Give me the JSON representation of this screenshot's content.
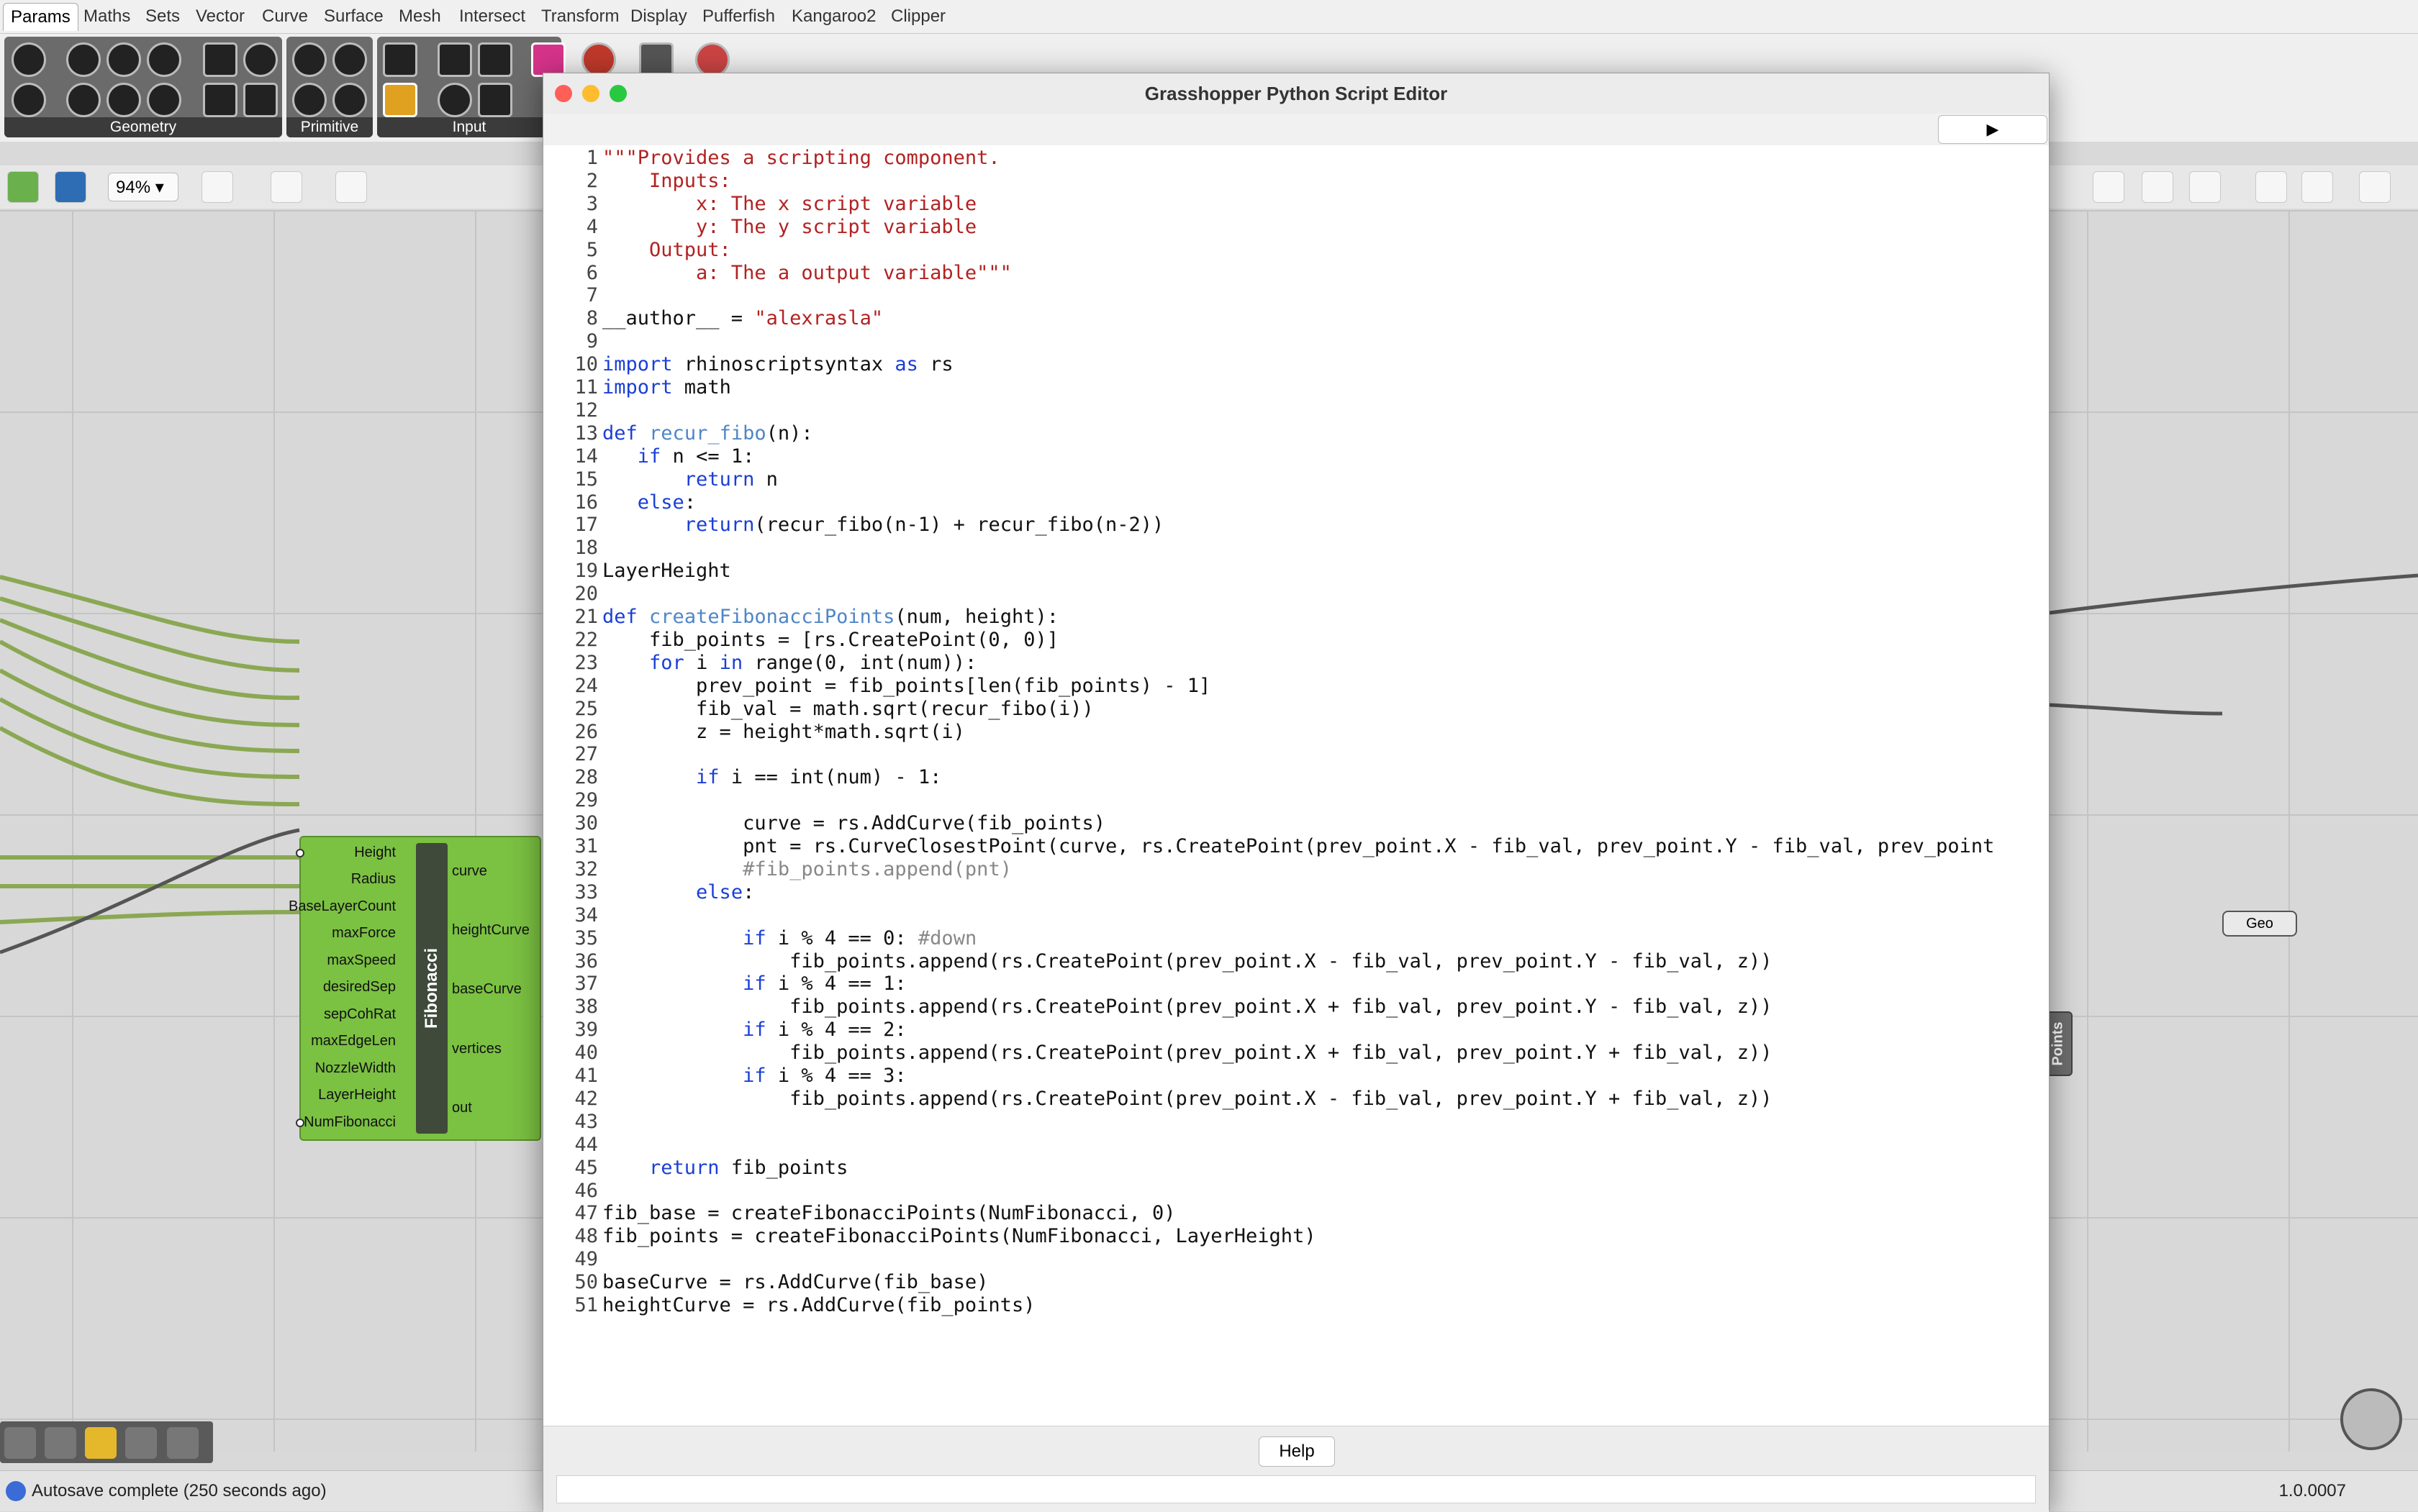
{
  "menu_tabs": [
    "Params",
    "Maths",
    "Sets",
    "Vector",
    "Curve",
    "Surface",
    "Mesh",
    "Intersect",
    "Transform",
    "Display",
    "Pufferfish",
    "Kangaroo2",
    "Clipper"
  ],
  "ribbon": {
    "groups": [
      "Geometry",
      "Primitive",
      "Input"
    ]
  },
  "toolbar": {
    "zoom": "94%"
  },
  "component": {
    "name": "Fibonacci",
    "inputs": [
      "Height",
      "Radius",
      "BaseLayerCount",
      "maxForce",
      "maxSpeed",
      "desiredSep",
      "sepCohRat",
      "maxEdgeLen",
      "NozzleWidth",
      "LayerHeight",
      "NumFibonacci"
    ],
    "outputs": [
      "curve",
      "heightCurve",
      "baseCurve",
      "vertices",
      "out"
    ]
  },
  "geo_param": "Geo",
  "points_param": "Points",
  "editor": {
    "title": "Grasshopper Python Script Editor",
    "run_label": "▶",
    "help_label": "Help",
    "lines": [
      "\"\"\"Provides a scripting component.",
      "    Inputs:",
      "        x: The x script variable",
      "        y: The y script variable",
      "    Output:",
      "        a: The a output variable\"\"\"",
      "",
      "__author__ = \"alexrasla\"",
      "",
      "import rhinoscriptsyntax as rs",
      "import math",
      "",
      "def recur_fibo(n):",
      "   if n <= 1:",
      "       return n",
      "   else:",
      "       return(recur_fibo(n-1) + recur_fibo(n-2))",
      "",
      "LayerHeight",
      "",
      "def createFibonacciPoints(num, height):",
      "    fib_points = [rs.CreatePoint(0, 0)]",
      "    for i in range(0, int(num)):",
      "        prev_point = fib_points[len(fib_points) - 1]",
      "        fib_val = math.sqrt(recur_fibo(i))",
      "        z = height*math.sqrt(i)",
      "",
      "        if i == int(num) - 1:",
      "",
      "            curve = rs.AddCurve(fib_points)",
      "            pnt = rs.CurveClosestPoint(curve, rs.CreatePoint(prev_point.X - fib_val, prev_point.Y - fib_val, prev_point",
      "            #fib_points.append(pnt)",
      "        else:",
      "",
      "            if i % 4 == 0: #down",
      "                fib_points.append(rs.CreatePoint(prev_point.X - fib_val, prev_point.Y - fib_val, z))",
      "            if i % 4 == 1:",
      "                fib_points.append(rs.CreatePoint(prev_point.X + fib_val, prev_point.Y - fib_val, z))",
      "            if i % 4 == 2:",
      "                fib_points.append(rs.CreatePoint(prev_point.X + fib_val, prev_point.Y + fib_val, z))",
      "            if i % 4 == 3:",
      "                fib_points.append(rs.CreatePoint(prev_point.X - fib_val, prev_point.Y + fib_val, z))",
      "",
      "",
      "    return fib_points",
      "",
      "fib_base = createFibonacciPoints(NumFibonacci, 0)",
      "fib_points = createFibonacciPoints(NumFibonacci, LayerHeight)",
      "",
      "baseCurve = rs.AddCurve(fib_base)",
      "heightCurve = rs.AddCurve(fib_points)"
    ]
  },
  "status": {
    "message": "Autosave complete (250 seconds ago)",
    "version": "1.0.0007"
  },
  "colors": {
    "string": "#b22222",
    "keyword": "#1a3fd6",
    "func": "#4f86c6",
    "comment": "#888888",
    "component": "#7bc142"
  }
}
